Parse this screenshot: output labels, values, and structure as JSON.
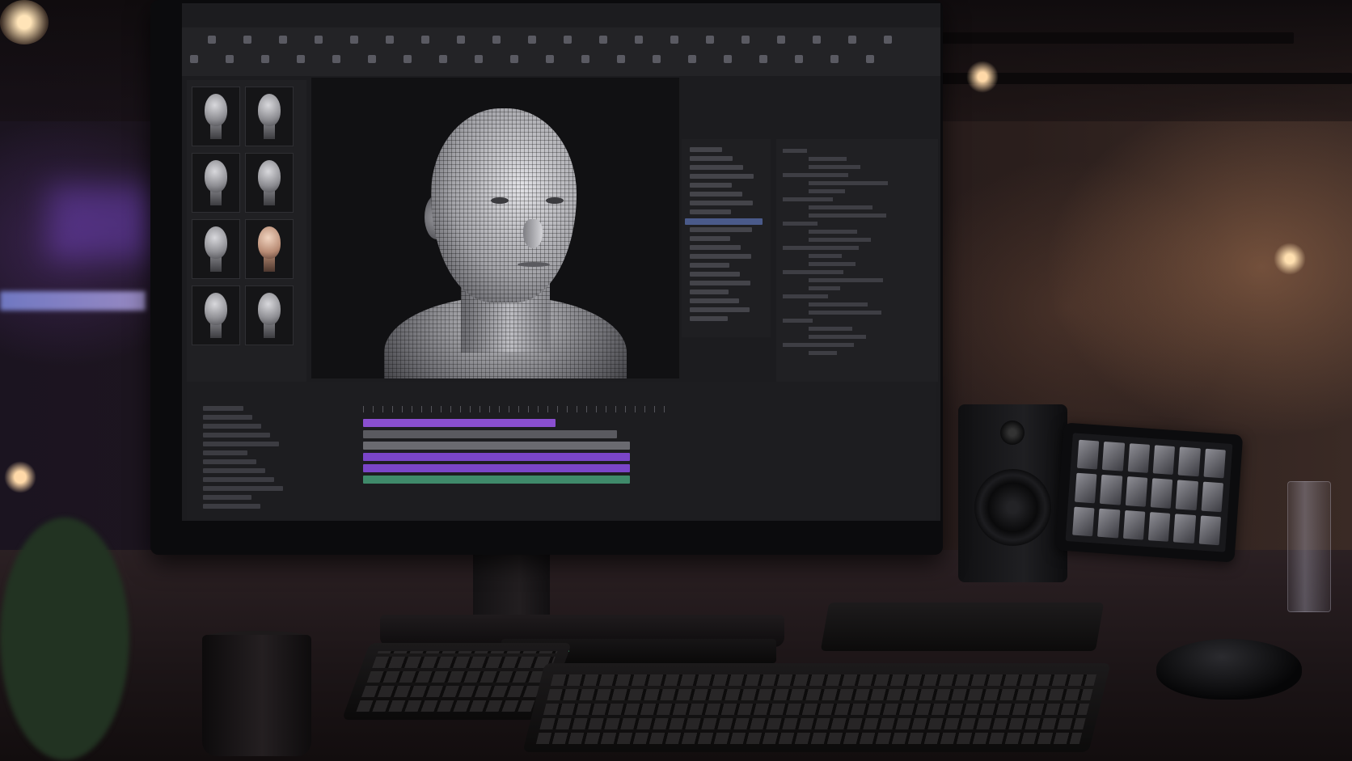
{
  "scene": {
    "description_colors": {
      "accent_purple": "#7a45c8",
      "timeline_green": "#3f8a6a",
      "selection_blue": "#4a5a8a",
      "ui_background": "#1c1c1f"
    }
  },
  "app": {
    "menus": [
      "",
      "",
      "",
      "",
      "",
      ""
    ],
    "library": {
      "thumbnails": [
        {
          "icon": "gray-head-icon",
          "style": "gray"
        },
        {
          "icon": "gray-head-icon",
          "style": "gray"
        },
        {
          "icon": "gray-head-icon",
          "style": "gray"
        },
        {
          "icon": "gray-head-icon",
          "style": "gray"
        },
        {
          "icon": "gray-head-icon",
          "style": "gray"
        },
        {
          "icon": "skin-head-icon",
          "style": "skin"
        },
        {
          "icon": "gray-head-icon",
          "style": "gray"
        },
        {
          "icon": "gray-head-icon",
          "style": "gray"
        }
      ]
    },
    "viewport": {
      "model_icon": "wireframe-head-bust-icon"
    },
    "timeline": {
      "tracks": [
        {
          "color": "#8a4fd0",
          "length": 0.72
        },
        {
          "color": "#5a5a60",
          "length": 0.95
        },
        {
          "color": "#6a6a70",
          "length": 1.0
        },
        {
          "color": "#7a45c8",
          "length": 1.0
        },
        {
          "color": "#7a45c8",
          "length": 1.0
        },
        {
          "color": "#3f8a6a",
          "length": 1.0
        }
      ]
    }
  },
  "desk": {
    "items": [
      "monitor",
      "keyboard",
      "numpad",
      "mouse",
      "mug",
      "speaker",
      "tablet",
      "glass",
      "control-pad"
    ]
  }
}
